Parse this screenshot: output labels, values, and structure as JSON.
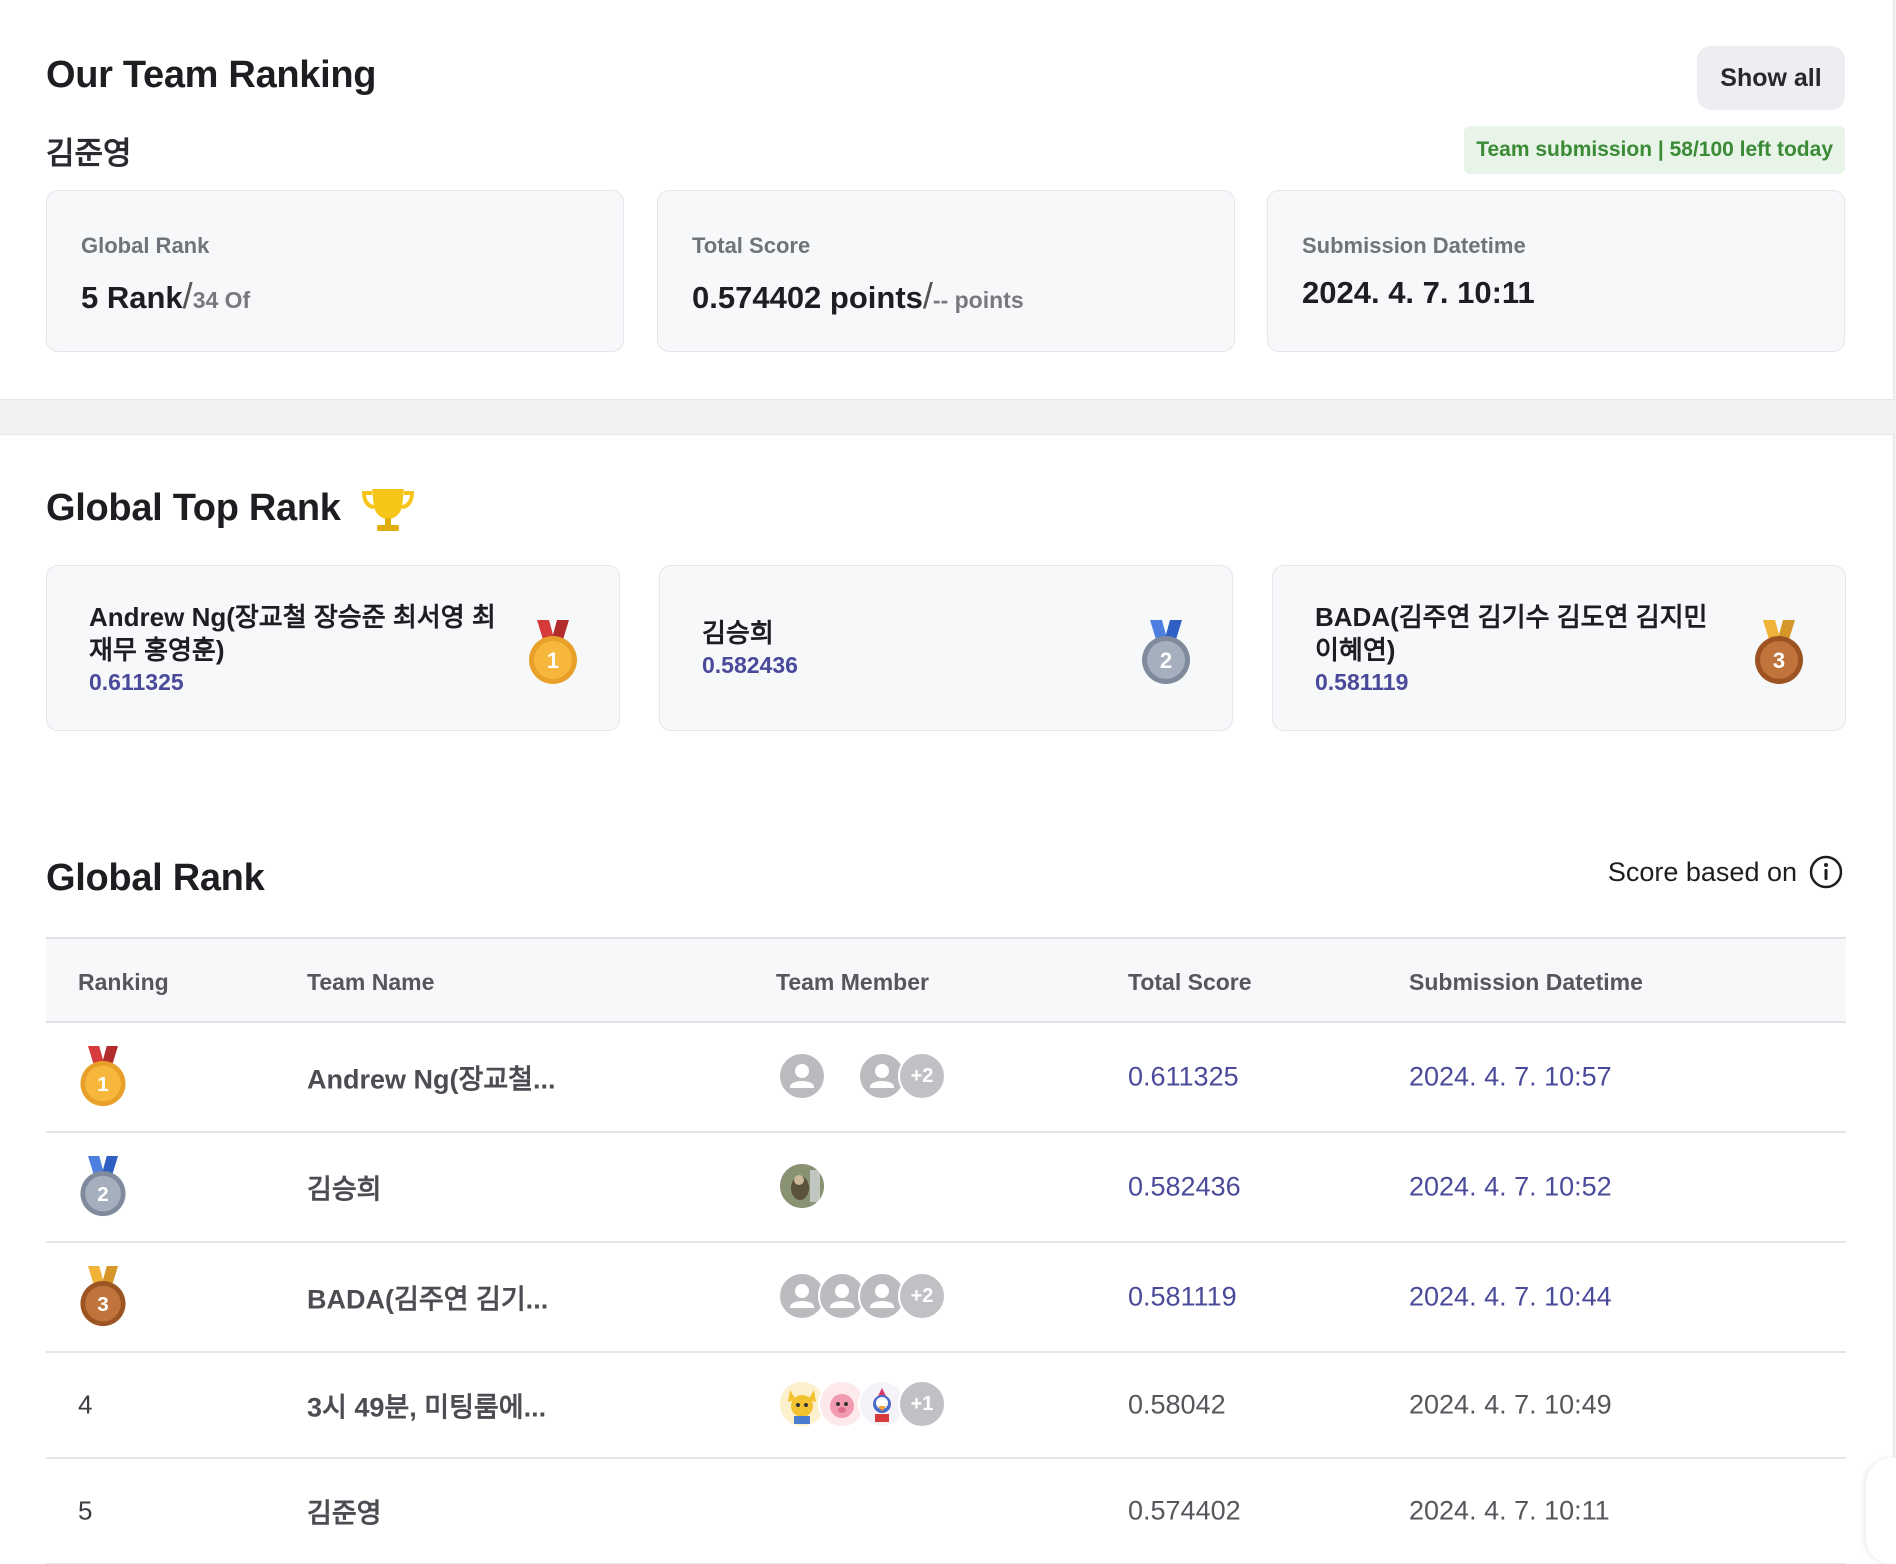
{
  "team_ranking": {
    "title": "Our Team Ranking",
    "show_all_label": "Show all",
    "team_name": "김준영",
    "submission_badge": "Team submission | 58/100 left today",
    "global_rank": {
      "label": "Global Rank",
      "value": "5 Rank",
      "total": "34 Of"
    },
    "total_score": {
      "label": "Total Score",
      "value": "0.574402 points",
      "sub": "-- points"
    },
    "submission_datetime": {
      "label": "Submission Datetime",
      "value": "2024. 4. 7. 10:11"
    }
  },
  "global_top": {
    "title": "Global Top Rank",
    "trophy_icon": "trophy-icon",
    "cards": [
      {
        "name": "Andrew Ng(장교철 장승준 최서영 최재무 홍영훈)",
        "score": "0.611325",
        "medal": "1"
      },
      {
        "name": "김승희",
        "score": "0.582436",
        "medal": "2"
      },
      {
        "name": "BADA(김주연 김기수 김도연 김지민 이혜연)",
        "score": "0.581119",
        "medal": "3"
      }
    ]
  },
  "global_rank": {
    "title": "Global Rank",
    "score_based_label": "Score based on",
    "info_icon": "info-icon",
    "columns": [
      "Ranking",
      "Team Name",
      "Team Member",
      "Total Score",
      "Submission Datetime"
    ],
    "rows": [
      {
        "rank": "1",
        "team": "Andrew Ng(장교철...",
        "members_more": "+2",
        "score": "0.611325",
        "date": "2024. 4. 7. 10:57"
      },
      {
        "rank": "2",
        "team": "김승희",
        "members_more": "",
        "score": "0.582436",
        "date": "2024. 4. 7. 10:52"
      },
      {
        "rank": "3",
        "team": "BADA(김주연 김기...",
        "members_more": "+2",
        "score": "0.581119",
        "date": "2024. 4. 7. 10:44"
      },
      {
        "rank": "4",
        "team": "3시 49분, 미팅룸에...",
        "members_more": "+1",
        "score": "0.58042",
        "date": "2024. 4. 7. 10:49"
      },
      {
        "rank": "5",
        "team": "김준영",
        "members_more": "",
        "score": "0.574402",
        "date": "2024. 4. 7. 10:11"
      }
    ]
  },
  "colors": {
    "medal_gold": "#f6b73c",
    "medal_silver": "#9aa4b4",
    "medal_bronze": "#b8682e",
    "accent_purple": "#4a4a9a",
    "badge_green": "#3a8a36"
  }
}
